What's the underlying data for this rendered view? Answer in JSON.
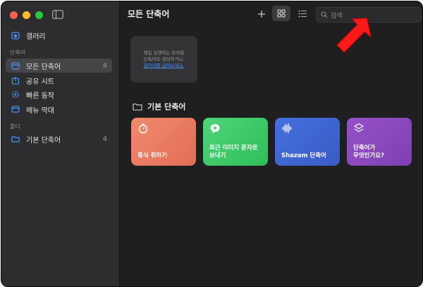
{
  "colors": {
    "accent_link": "#4b8ef0",
    "arrow": "#ff1a1a",
    "tile_orange": "#ea7a60",
    "tile_green": "#3ac866",
    "tile_blue": "#3f66d1",
    "tile_purple": "#8a48bf"
  },
  "sidebar": {
    "gallery": {
      "label": "갤러리",
      "icon": "gallery-icon"
    },
    "section_shortcuts": "단축어",
    "items": [
      {
        "label": "모든 단축어",
        "count": "4",
        "icon": "all-shortcuts-icon"
      },
      {
        "label": "공유 시트",
        "icon": "share-sheet-icon"
      },
      {
        "label": "빠른 동작",
        "icon": "quick-actions-icon"
      },
      {
        "label": "메뉴 막대",
        "icon": "menu-bar-icon"
      }
    ],
    "section_folders": "폴더",
    "folders": [
      {
        "label": "기본 단축어",
        "count": "4",
        "icon": "folder-icon"
      }
    ]
  },
  "header": {
    "title": "모든 단축어",
    "search_placeholder": "검색"
  },
  "hint": {
    "line1": "매일 실행하는 동작을",
    "line2": "단축어로 생성하거나,",
    "link": "갤러리를 살펴보세요."
  },
  "folder_section": {
    "title": "기본 단축어"
  },
  "tiles": [
    {
      "label_line1": "휴식 취하기",
      "label_line2": "",
      "icon": "timer-icon"
    },
    {
      "label_line1": "최근 이미지 문자로",
      "label_line2": "보내기",
      "icon": "message-icon"
    },
    {
      "label_line1": "Shazam 단축어",
      "label_line2": "",
      "icon": "waveform-icon"
    },
    {
      "label_line1": "단축어가",
      "label_line2": "무엇인가요?",
      "icon": "shortcuts-icon"
    }
  ]
}
